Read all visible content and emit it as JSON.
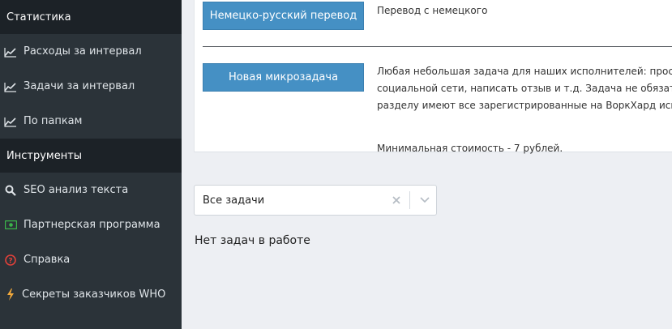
{
  "sidebar": {
    "section_stats": "Статистика",
    "stats_items": [
      {
        "label": "Расходы за интервал",
        "icon": "chart-line-icon"
      },
      {
        "label": "Задачи за интервал",
        "icon": "chart-line-icon"
      },
      {
        "label": "По папкам",
        "icon": "chart-line-icon"
      }
    ],
    "section_tools": "Инструменты",
    "tools_items": [
      {
        "label": "SEO анализ текста",
        "icon": "search-icon"
      },
      {
        "label": "Партнерская программа",
        "icon": "money-icon"
      },
      {
        "label": "Справка",
        "icon": "help-icon"
      },
      {
        "label": "Секреты заказчиков WHO",
        "icon": "lightning-icon"
      }
    ]
  },
  "tasks": [
    {
      "button": "Немецко-русский перевод",
      "lines": [
        "Перевод с немецкого"
      ]
    },
    {
      "button": "Новая микрозадача",
      "lines": [
        "Любая небольшая задача для наших исполнителей: просьба",
        "социальной сети, написать отзыв и т.д. Задача не обязатель",
        "разделу имеют все зарегистрированные на ВоркХард испол"
      ],
      "min_price": "Минимальная стоимость - 7 рублей."
    }
  ],
  "filter": {
    "value": "Все задачи"
  },
  "empty_message": "Нет задач в работе",
  "colors": {
    "sidebar_bg": "#2b3339",
    "sidebar_section_bg": "#1c2227",
    "button_bg": "#4590c4",
    "money_icon": "#3bb54a",
    "help_icon": "#e0413a",
    "lightning_icon": "#f2a93b"
  }
}
